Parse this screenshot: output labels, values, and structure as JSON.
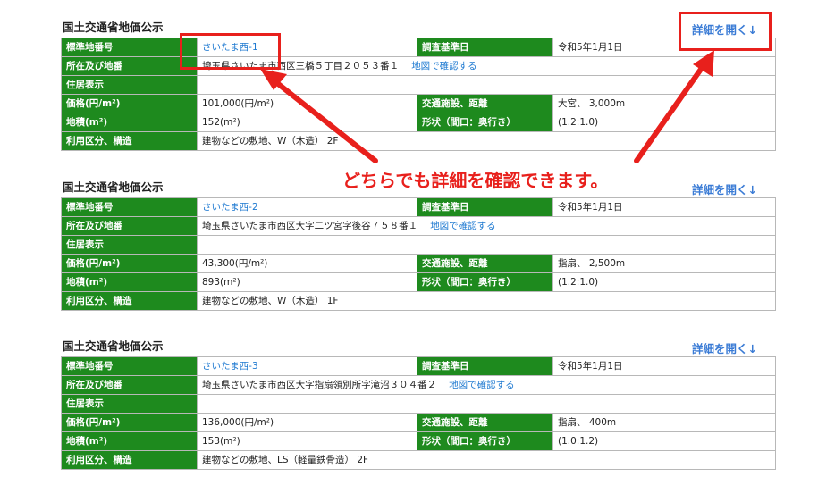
{
  "entries": [
    {
      "title": "国土交通省地価公示",
      "detail_link": "詳細を開く↓",
      "labels": {
        "number": "標準地番号",
        "address": "所在及び地番",
        "residence": "住居表示",
        "price": "価格(円/m²)",
        "area": "地積(m²)",
        "usage": "利用区分、構造",
        "survey_date": "調査基準日",
        "transport": "交通施設、距離",
        "shape": "形状（間口：奥行き）"
      },
      "number": "さいたま西-1",
      "address": "埼玉県さいたま市西区三橋５丁目２０５３番１",
      "map_link": "地図で確認する",
      "residence": "",
      "price": "101,000(円/m²)",
      "area": "152(m²)",
      "usage": "建物などの敷地、W（木造） 2F",
      "survey_date": "令和5年1月1日",
      "transport": "大宮、 3,000m",
      "shape": "(1.2:1.0)"
    },
    {
      "title": "国土交通省地価公示",
      "detail_link": "詳細を開く↓",
      "labels": {
        "number": "標準地番号",
        "address": "所在及び地番",
        "residence": "住居表示",
        "price": "価格(円/m²)",
        "area": "地積(m²)",
        "usage": "利用区分、構造",
        "survey_date": "調査基準日",
        "transport": "交通施設、距離",
        "shape": "形状（間口：奥行き）"
      },
      "number": "さいたま西-2",
      "address": "埼玉県さいたま市西区大字二ツ宮字後谷７５８番１",
      "map_link": "地図で確認する",
      "residence": "",
      "price": "43,300(円/m²)",
      "area": "893(m²)",
      "usage": "建物などの敷地、W（木造） 1F",
      "survey_date": "令和5年1月1日",
      "transport": "指扇、 2,500m",
      "shape": "(1.2:1.0)"
    },
    {
      "title": "国土交通省地価公示",
      "detail_link": "詳細を開く↓",
      "labels": {
        "number": "標準地番号",
        "address": "所在及び地番",
        "residence": "住居表示",
        "price": "価格(円/m²)",
        "area": "地積(m²)",
        "usage": "利用区分、構造",
        "survey_date": "調査基準日",
        "transport": "交通施設、距離",
        "shape": "形状（間口：奥行き）"
      },
      "number": "さいたま西-3",
      "address": "埼玉県さいたま市西区大字指扇領別所字滝沼３０４番２",
      "map_link": "地図で確認する",
      "residence": "",
      "price": "136,000(円/m²)",
      "area": "153(m²)",
      "usage": "建物などの敷地、LS（軽量鉄骨造） 2F",
      "survey_date": "令和5年1月1日",
      "transport": "指扇、 400m",
      "shape": "(1.0:1.2)"
    }
  ],
  "annotation": {
    "callout_text": "どちらでも詳細を確認できます。",
    "color": "#e8201c"
  },
  "colors": {
    "label_bg": "#1e8a1e",
    "link": "#1f7ad1",
    "detail_link": "#3a7bd5"
  }
}
